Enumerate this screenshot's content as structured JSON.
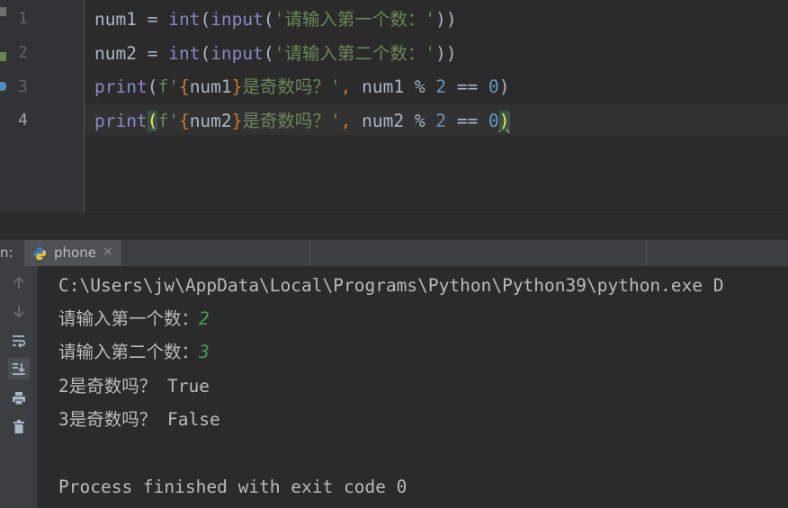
{
  "editor": {
    "line_numbers": [
      "1",
      "2",
      "3",
      "4"
    ],
    "lines": [
      [
        {
          "t": "num1 ",
          "c": "cv"
        },
        {
          "t": "=",
          "c": "cv"
        },
        {
          "t": " ",
          "c": "cv"
        },
        {
          "t": "int",
          "c": "cb"
        },
        {
          "t": "(",
          "c": "cv"
        },
        {
          "t": "input",
          "c": "cb"
        },
        {
          "t": "(",
          "c": "cv"
        },
        {
          "t": "'请输入第一个数：'",
          "c": "cs"
        },
        {
          "t": "))",
          "c": "cv"
        }
      ],
      [
        {
          "t": "num2 ",
          "c": "cv"
        },
        {
          "t": "=",
          "c": "cv"
        },
        {
          "t": " ",
          "c": "cv"
        },
        {
          "t": "int",
          "c": "cb"
        },
        {
          "t": "(",
          "c": "cv"
        },
        {
          "t": "input",
          "c": "cb"
        },
        {
          "t": "(",
          "c": "cv"
        },
        {
          "t": "'请输入第二个数：'",
          "c": "cs"
        },
        {
          "t": "))",
          "c": "cv"
        }
      ],
      [
        {
          "t": "print",
          "c": "cb"
        },
        {
          "t": "(",
          "c": "cv"
        },
        {
          "t": "f'",
          "c": "cs"
        },
        {
          "t": "{",
          "c": "cbr"
        },
        {
          "t": "num1",
          "c": "cv"
        },
        {
          "t": "}",
          "c": "cbr"
        },
        {
          "t": "是奇数吗？'",
          "c": "cs"
        },
        {
          "t": ",",
          "c": "ci"
        },
        {
          "t": " num1 % ",
          "c": "cv"
        },
        {
          "t": "2",
          "c": "cn"
        },
        {
          "t": " == ",
          "c": "cv"
        },
        {
          "t": "0",
          "c": "cn"
        },
        {
          "t": ")",
          "c": "cv"
        }
      ],
      [
        {
          "t": "print",
          "c": "cb"
        },
        {
          "t": "(",
          "c": "paren-hl"
        },
        {
          "t": "f'",
          "c": "cs"
        },
        {
          "t": "{",
          "c": "cbr"
        },
        {
          "t": "num2",
          "c": "cv"
        },
        {
          "t": "}",
          "c": "cbr"
        },
        {
          "t": "是奇数吗？'",
          "c": "cs"
        },
        {
          "t": ",",
          "c": "ci"
        },
        {
          "t": " num2 % ",
          "c": "cv"
        },
        {
          "t": "2",
          "c": "cn"
        },
        {
          "t": " == ",
          "c": "cv"
        },
        {
          "t": "0",
          "c": "cn"
        },
        {
          "t": ")",
          "c": "paren-hl squiggle"
        }
      ]
    ]
  },
  "run_panel": {
    "label": "n:",
    "tab": {
      "label": "phone",
      "close": "×",
      "icon": "python-icon"
    },
    "toolbar_icons": [
      "arrow-up-icon",
      "arrow-down-icon",
      "soft-wrap-icon",
      "scroll-to-end-icon",
      "print-icon",
      "trash-icon"
    ],
    "console": {
      "command": "C:\\Users\\jw\\AppData\\Local\\Programs\\Python\\Python39\\python.exe D",
      "prompt1": "请输入第一个数：",
      "input1": "2",
      "prompt2": "请输入第二个数：",
      "input2": "3",
      "result1": "2是奇数吗？ True",
      "result2": "3是奇数吗？ False",
      "blank": "",
      "finish": "Process finished with exit code 0"
    }
  },
  "colors": {
    "background": "#2b2b2b",
    "builtin": "#8888c6",
    "string": "#6a8759",
    "number": "#6897bb",
    "input_echo": "#499c54"
  }
}
